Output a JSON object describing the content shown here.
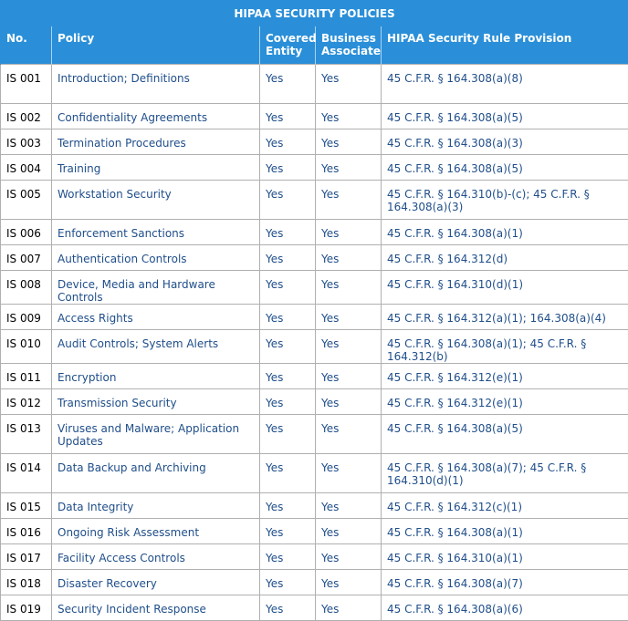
{
  "title": "HIPAA SECURITY POLICIES",
  "columns": [
    "No.",
    "Policy",
    "Covered Entity",
    "Business Associate",
    "HIPAA Security Rule Provision"
  ],
  "rows": [
    {
      "no": "IS 001",
      "policy": "Introduction; Definitions",
      "ce": "Yes",
      "ba": "Yes",
      "provision": "45 C.F.R. § 164.308(a)(8)"
    },
    {
      "no": "IS 002",
      "policy": "Confidentiality Agreements",
      "ce": "Yes",
      "ba": "Yes",
      "provision": "45 C.F.R. § 164.308(a)(5)"
    },
    {
      "no": "IS 003",
      "policy": "Termination Procedures",
      "ce": "Yes",
      "ba": "Yes",
      "provision": "45 C.F.R. § 164.308(a)(3)"
    },
    {
      "no": "IS 004",
      "policy": "Training",
      "ce": "Yes",
      "ba": "Yes",
      "provision": "45 C.F.R. § 164.308(a)(5)"
    },
    {
      "no": "IS 005",
      "policy": "Workstation Security",
      "ce": "Yes",
      "ba": "Yes",
      "provision": "45 C.F.R. § 164.310(b)-(c); 45 C.F.R. § 164.308(a)(3)"
    },
    {
      "no": "IS 006",
      "policy": "Enforcement Sanctions",
      "ce": "Yes",
      "ba": "Yes",
      "provision": "45 C.F.R. § 164.308(a)(1)"
    },
    {
      "no": "IS 007",
      "policy": "Authentication Controls",
      "ce": "Yes",
      "ba": "Yes",
      "provision": "45 C.F.R. § 164.312(d)"
    },
    {
      "no": "IS 008",
      "policy": "Device, Media and Hardware Controls",
      "ce": "Yes",
      "ba": "Yes",
      "provision": "45 C.F.R. § 164.310(d)(1)"
    },
    {
      "no": "IS 009",
      "policy": "Access Rights",
      "ce": "Yes",
      "ba": "Yes",
      "provision": "45 C.F.R. § 164.312(a)(1); 164.308(a)(4)"
    },
    {
      "no": "IS 010",
      "policy": "Audit Controls; System Alerts",
      "ce": "Yes",
      "ba": "Yes",
      "provision": "45 C.F.R. § 164.308(a)(1); 45 C.F.R. § 164.312(b)"
    },
    {
      "no": "IS 011",
      "policy": "Encryption",
      "ce": "Yes",
      "ba": "Yes",
      "provision": "45 C.F.R. § 164.312(e)(1)"
    },
    {
      "no": "IS 012",
      "policy": "Transmission Security",
      "ce": "Yes",
      "ba": "Yes",
      "provision": "45 C.F.R. § 164.312(e)(1)"
    },
    {
      "no": "IS 013",
      "policy": "Viruses and Malware; Application Updates",
      "ce": "Yes",
      "ba": "Yes",
      "provision": "45 C.F.R. § 164.308(a)(5)"
    },
    {
      "no": "IS 014",
      "policy": "Data Backup and Archiving",
      "ce": "Yes",
      "ba": "Yes",
      "provision": "45 C.F.R. § 164.308(a)(7); 45 C.F.R. § 164.310(d)(1)"
    },
    {
      "no": "IS 015",
      "policy": "Data Integrity",
      "ce": "Yes",
      "ba": "Yes",
      "provision": "45 C.F.R. § 164.312(c)(1)"
    },
    {
      "no": "IS 016",
      "policy": "Ongoing Risk Assessment",
      "ce": "Yes",
      "ba": "Yes",
      "provision": "45 C.F.R. § 164.308(a)(1)"
    },
    {
      "no": "IS 017",
      "policy": "Facility Access Controls",
      "ce": "Yes",
      "ba": "Yes",
      "provision": "45 C.F.R. § 164.310(a)(1)"
    },
    {
      "no": "IS 018",
      "policy": "Disaster Recovery",
      "ce": "Yes",
      "ba": "Yes",
      "provision": "45 C.F.R. § 164.308(a)(7)"
    },
    {
      "no": "IS 019",
      "policy": "Security Incident Response",
      "ce": "Yes",
      "ba": "Yes",
      "provision": "45 C.F.R. § 164.308(a)(6)"
    }
  ]
}
